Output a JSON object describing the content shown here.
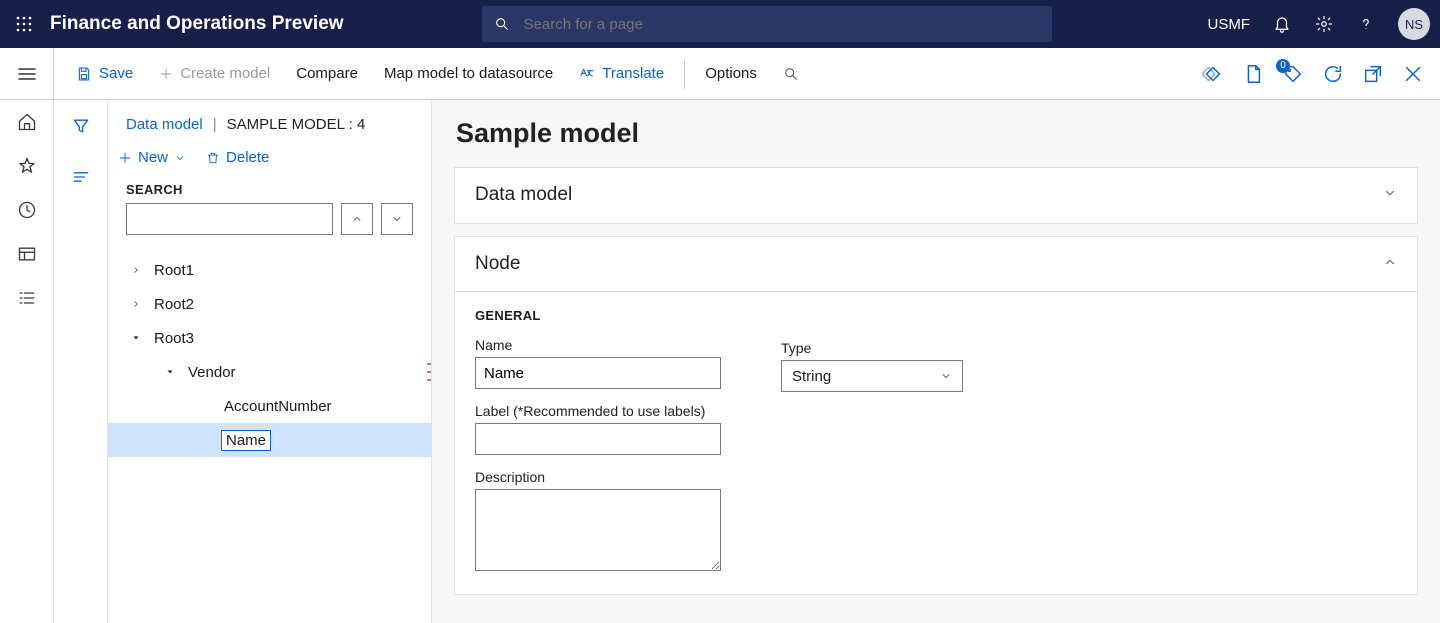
{
  "app": {
    "title": "Finance and Operations Preview",
    "search_placeholder": "Search for a page"
  },
  "top_right": {
    "company": "USMF",
    "avatar_initials": "NS"
  },
  "cmdbar": {
    "save": "Save",
    "create_model": "Create model",
    "compare": "Compare",
    "map_model": "Map model to datasource",
    "translate": "Translate",
    "options": "Options",
    "badge_count": "0"
  },
  "breadcrumb": {
    "root": "Data model",
    "current": "SAMPLE MODEL : 4"
  },
  "tree_actions": {
    "new": "New",
    "delete": "Delete"
  },
  "side_search": {
    "label": "SEARCH"
  },
  "tree": {
    "items": [
      {
        "label": "Root1",
        "depth": 0,
        "expander": "right",
        "selected": false
      },
      {
        "label": "Root2",
        "depth": 0,
        "expander": "right",
        "selected": false
      },
      {
        "label": "Root3",
        "depth": 0,
        "expander": "down",
        "selected": false
      },
      {
        "label": "Vendor",
        "depth": 1,
        "expander": "down",
        "selected": false,
        "marker": true
      },
      {
        "label": "AccountNumber",
        "depth": 2,
        "expander": "",
        "selected": false
      },
      {
        "label": "Name",
        "depth": 2,
        "expander": "",
        "selected": true
      }
    ]
  },
  "page": {
    "title": "Sample model"
  },
  "panels": {
    "data_model": {
      "title": "Data model"
    },
    "node": {
      "title": "Node",
      "general_label": "GENERAL",
      "name_label": "Name",
      "name_value": "Name",
      "label_label": "Label (*Recommended to use labels)",
      "label_value": "",
      "description_label": "Description",
      "description_value": "",
      "type_label": "Type",
      "type_value": "String"
    }
  }
}
